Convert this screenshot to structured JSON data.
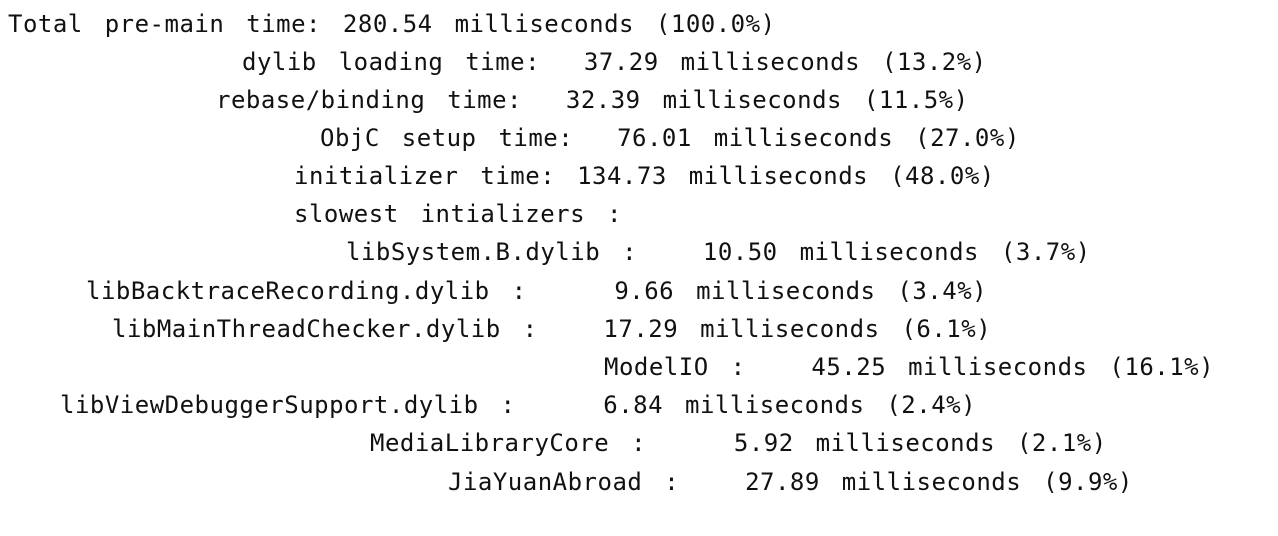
{
  "terminal": {
    "lines": [
      "Total pre-main time: 280.54 milliseconds (100.0%)",
      "dylib loading time:  37.29 milliseconds (13.2%)",
      "rebase/binding time:  32.39 milliseconds (11.5%)",
      "ObjC setup time:  76.01 milliseconds (27.0%)",
      "initializer time: 134.73 milliseconds (48.0%)",
      "slowest intializers :",
      "libSystem.B.dylib :   10.50 milliseconds (3.7%)",
      "libBacktraceRecording.dylib :    9.66 milliseconds (3.4%)",
      "libMainThreadChecker.dylib :   17.29 milliseconds (6.1%)",
      "ModelIO :   45.25 milliseconds (16.1%)",
      "libViewDebuggerSupport.dylib :    6.84 milliseconds (2.4%)",
      "MediaLibraryCore :    5.92 milliseconds (2.1%)",
      "JiaYuanAbroad :   27.89 milliseconds (9.9%)"
    ]
  }
}
